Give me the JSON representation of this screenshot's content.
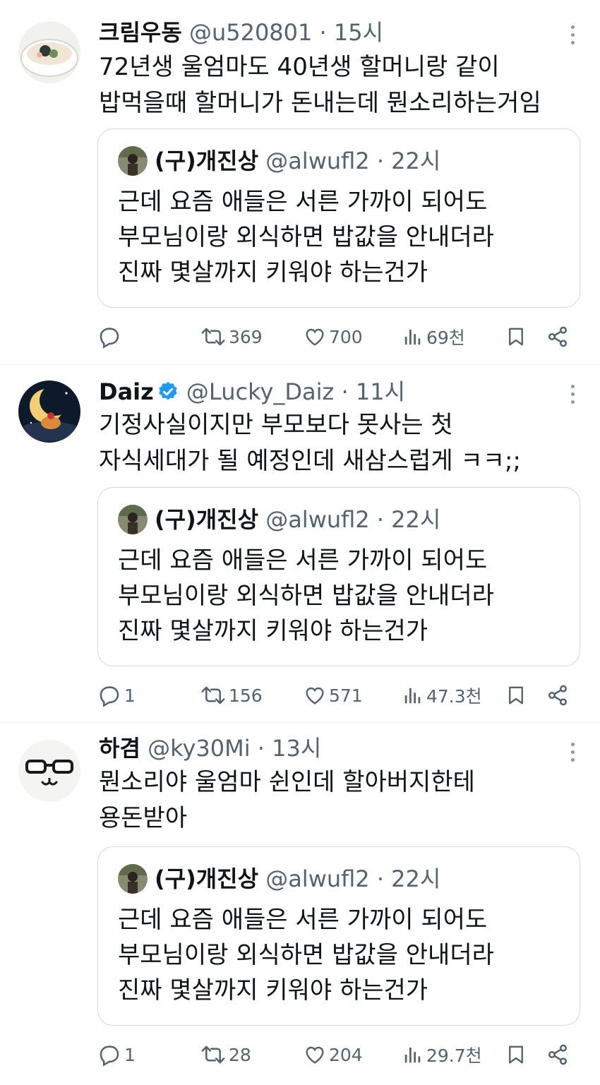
{
  "quoted": {
    "name": "(구)개진상",
    "meta": "@alwufl2 · 22시",
    "lines": [
      "근데 요즘 애들은 서른 가까이 되어도",
      "부모님이랑 외식하면 밥값을 안내더라",
      "진짜 몇살까지 키워야 하는건가"
    ]
  },
  "tweets": [
    {
      "name": "크림우동",
      "meta": "@u520801 · 15시",
      "lines": [
        "72년생 울엄마도 40년생 할머니랑 같이",
        "밥먹을때 할머니가 돈내는데 뭔소리하는거임"
      ],
      "reply_count": "",
      "retweet_count": "369",
      "like_count": "700",
      "view_count": "69천"
    },
    {
      "name": "Daiz",
      "meta": "@Lucky_Daiz · 11시",
      "verified": true,
      "lines": [
        "기정사실이지만 부모보다 못사는 첫",
        "자식세대가 될 예정인데 새삼스럽게 ㅋㅋ;;"
      ],
      "reply_count": "1",
      "retweet_count": "156",
      "like_count": "571",
      "view_count": "47.3천"
    },
    {
      "name": "하겸",
      "meta": "@ky30Mi · 13시",
      "lines": [
        "뭔소리야 울엄마 쉰인데 할아버지한테",
        "용돈받아"
      ],
      "reply_count": "1",
      "retweet_count": "28",
      "like_count": "204",
      "view_count": "29.7천"
    }
  ],
  "icons": [
    "reply-icon",
    "retweet-icon",
    "like-icon",
    "views-icon",
    "bookmark-icon",
    "share-icon",
    "verified-badge-icon",
    "more-icon"
  ],
  "colors": {
    "text": "#0f1419",
    "secondary": "#536471",
    "border": "#cfd9de",
    "verified": "#1d9bf0"
  }
}
